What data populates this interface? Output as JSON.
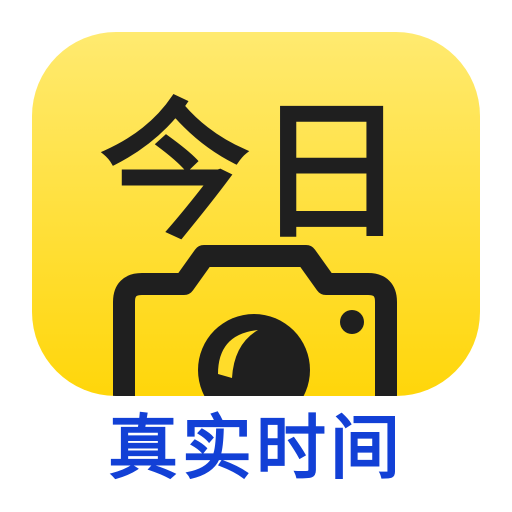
{
  "brand": {
    "logo_text": "今日",
    "tagline": "真实时间",
    "colors": {
      "icon_background_top": "#ffe96a",
      "icon_background_bottom": "#ffd60a",
      "logo_ink": "#1f1f1f",
      "tagline": "#1240d6",
      "page_background": "#ffffff"
    },
    "icon": "camera-icon"
  }
}
